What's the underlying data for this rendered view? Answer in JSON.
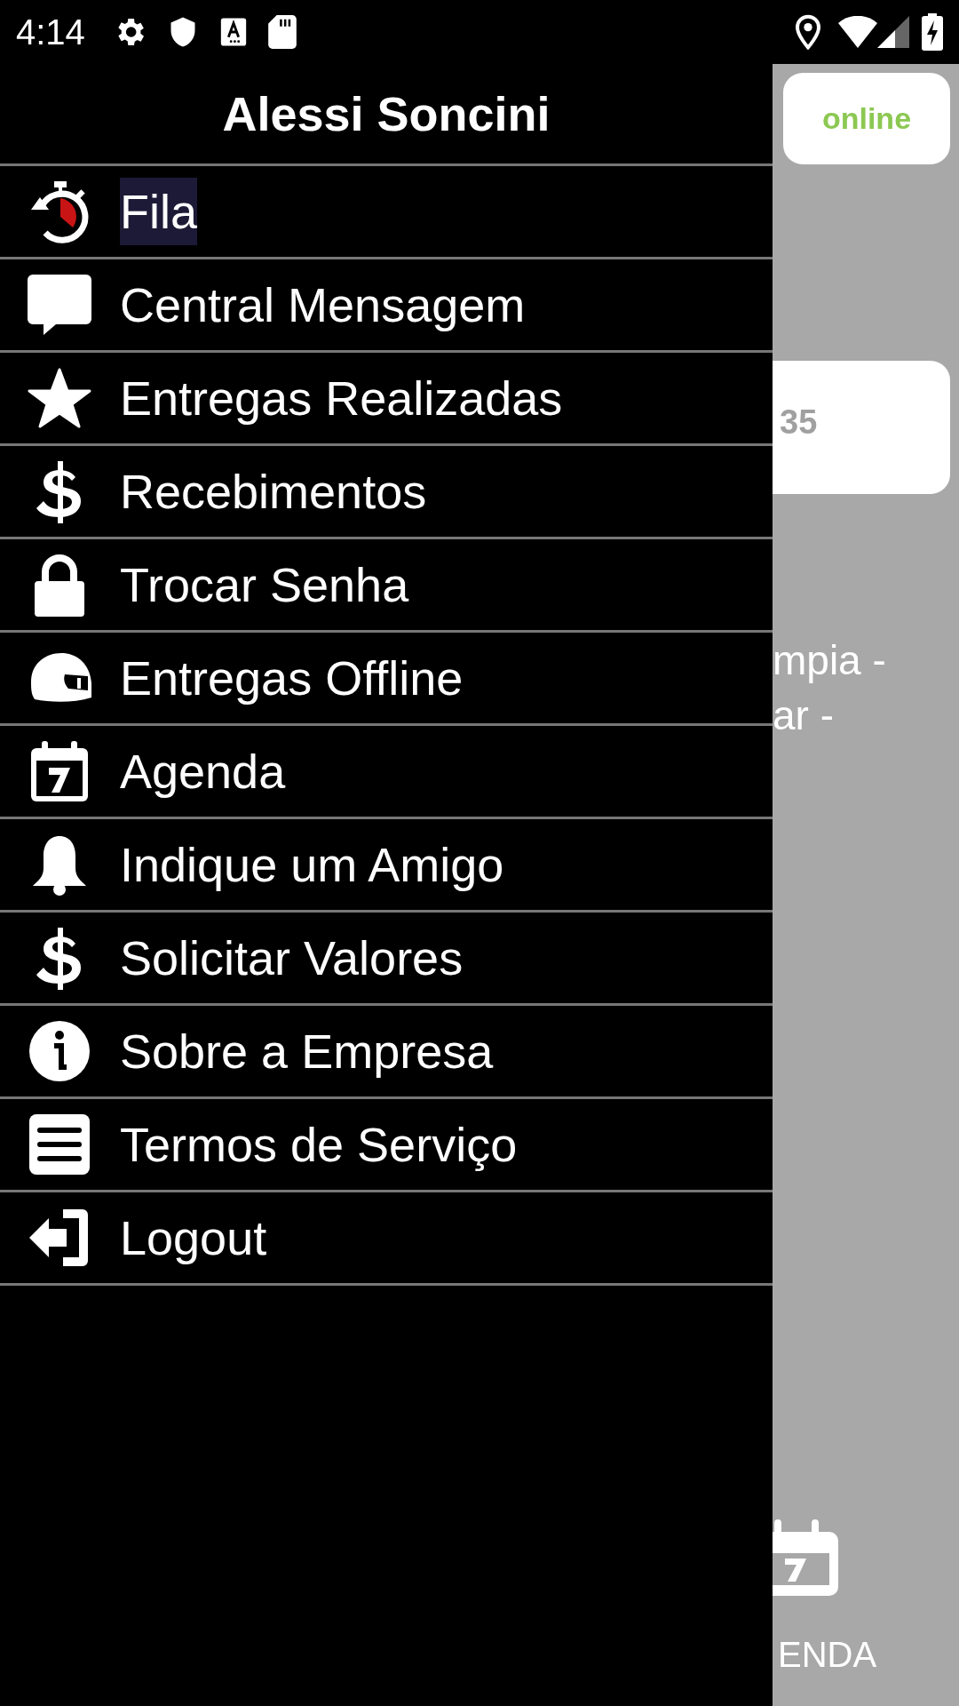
{
  "status_bar": {
    "time": "4:14"
  },
  "drawer": {
    "title": "Alessi Soncini",
    "items": [
      {
        "label": "Fila",
        "selected": true
      },
      {
        "label": "Central Mensagem",
        "selected": false
      },
      {
        "label": "Entregas Realizadas",
        "selected": false
      },
      {
        "label": "Recebimentos",
        "selected": false
      },
      {
        "label": "Trocar Senha",
        "selected": false
      },
      {
        "label": "Entregas Offline",
        "selected": false
      },
      {
        "label": "Agenda",
        "selected": false
      },
      {
        "label": "Indique um Amigo",
        "selected": false
      },
      {
        "label": "Solicitar Valores",
        "selected": false
      },
      {
        "label": "Sobre a Empresa",
        "selected": false
      },
      {
        "label": "Termos de Serviço",
        "selected": false
      },
      {
        "label": "Logout",
        "selected": false
      }
    ]
  },
  "background": {
    "status_badge": "online",
    "card_value": "35",
    "address_lines": [
      "mpia -",
      "ar -"
    ],
    "bottom_tab_label": "ENDA"
  }
}
